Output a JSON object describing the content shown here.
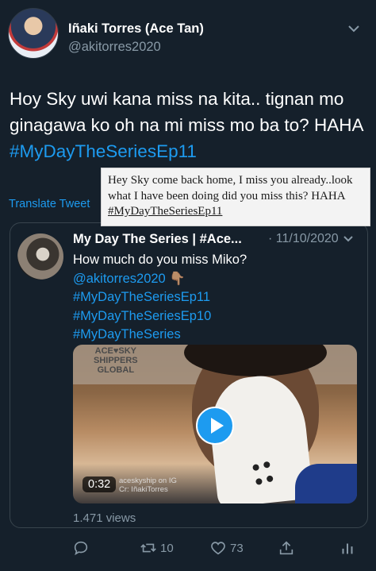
{
  "author": {
    "display_name": "Iñaki Torres (Ace Tan)",
    "handle": "@akitorres2020"
  },
  "tweet": {
    "text_main": "Hoy Sky uwi kana miss na kita.. tignan mo ginagawa ko oh na mi miss mo ba to? HAHA ",
    "hashtag": "#MyDayTheSeriesEp11",
    "translate_label": "Translate Tweet"
  },
  "translation_overlay": {
    "text": "Hey Sky come back home, I miss you already..look what I have been doing did you miss this? HAHA ",
    "hashtag": "#MyDayTheSeriesEp11"
  },
  "quoted": {
    "name": "My Day The Series | #Ace...",
    "date": "· 11/10/2020",
    "line1": "How much do you miss Miko?",
    "mention": "@akitorres2020 👇🏽",
    "tags": [
      "#MyDayTheSeriesEp11",
      "#MyDayTheSeriesEp10",
      "#MyDayTheSeries"
    ],
    "video": {
      "duration": "0:32",
      "logo_line1": "ACE♥SKY",
      "logo_line2": "SHIPPERS",
      "logo_line3": "GLOBAL",
      "watermark_line1": "aceskyship on IG",
      "watermark_line2": "Cr: IñakiTorres"
    }
  },
  "views": "1.471 views",
  "actions": {
    "reply_icon": "reply-icon",
    "retweet_count": "10",
    "like_count": "73",
    "share_icon": "share-icon",
    "analytics_icon": "analytics-icon"
  },
  "colors": {
    "background": "#15202b",
    "accent": "#1d9bf0",
    "secondary_text": "#8899a6"
  }
}
